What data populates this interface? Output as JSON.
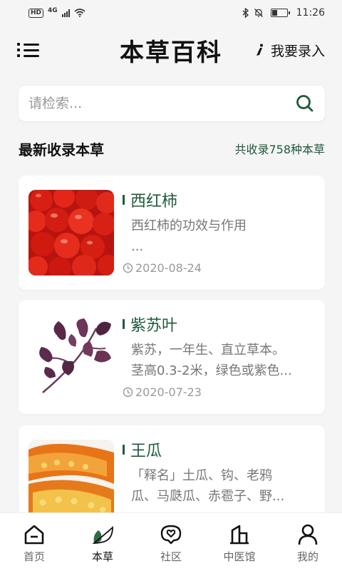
{
  "status_bar": {
    "hd": "HD",
    "network": "4G",
    "time": "11:26",
    "battery_level": 0.35
  },
  "header": {
    "title": "本草百科",
    "entry_label": "我要录入"
  },
  "search": {
    "placeholder": "请检索..."
  },
  "section": {
    "title": "最新收录本草",
    "count_label": "共收录758种本草"
  },
  "herbs": [
    {
      "name": "西红柿",
      "desc_line1": "西红柿的功效与作用",
      "desc_line2": "...",
      "date": "2020-08-24",
      "image": "tomatoes-photo"
    },
    {
      "name": "紫苏叶",
      "desc_line1": "紫苏，一年生、直立草本。",
      "desc_line2": "茎高0.3-2米，绿色或紫色...",
      "date": "2020-07-23",
      "image": "perilla-leaf-photo"
    },
    {
      "name": "王瓜",
      "desc_line1": "「释名」土瓜、钩、老鸦",
      "desc_line2": "瓜、马瓞瓜、赤雹子、野...",
      "date": "",
      "image": "snake-gourd-photo"
    }
  ],
  "bottom_nav": [
    {
      "label": "首页",
      "icon": "home-icon"
    },
    {
      "label": "本草",
      "icon": "leaf-icon",
      "active": true
    },
    {
      "label": "社区",
      "icon": "community-icon"
    },
    {
      "label": "中医馆",
      "icon": "hall-icon"
    },
    {
      "label": "我的",
      "icon": "profile-icon"
    }
  ],
  "colors": {
    "accent": "#1f5a3a",
    "background": "#f5f5f5"
  }
}
